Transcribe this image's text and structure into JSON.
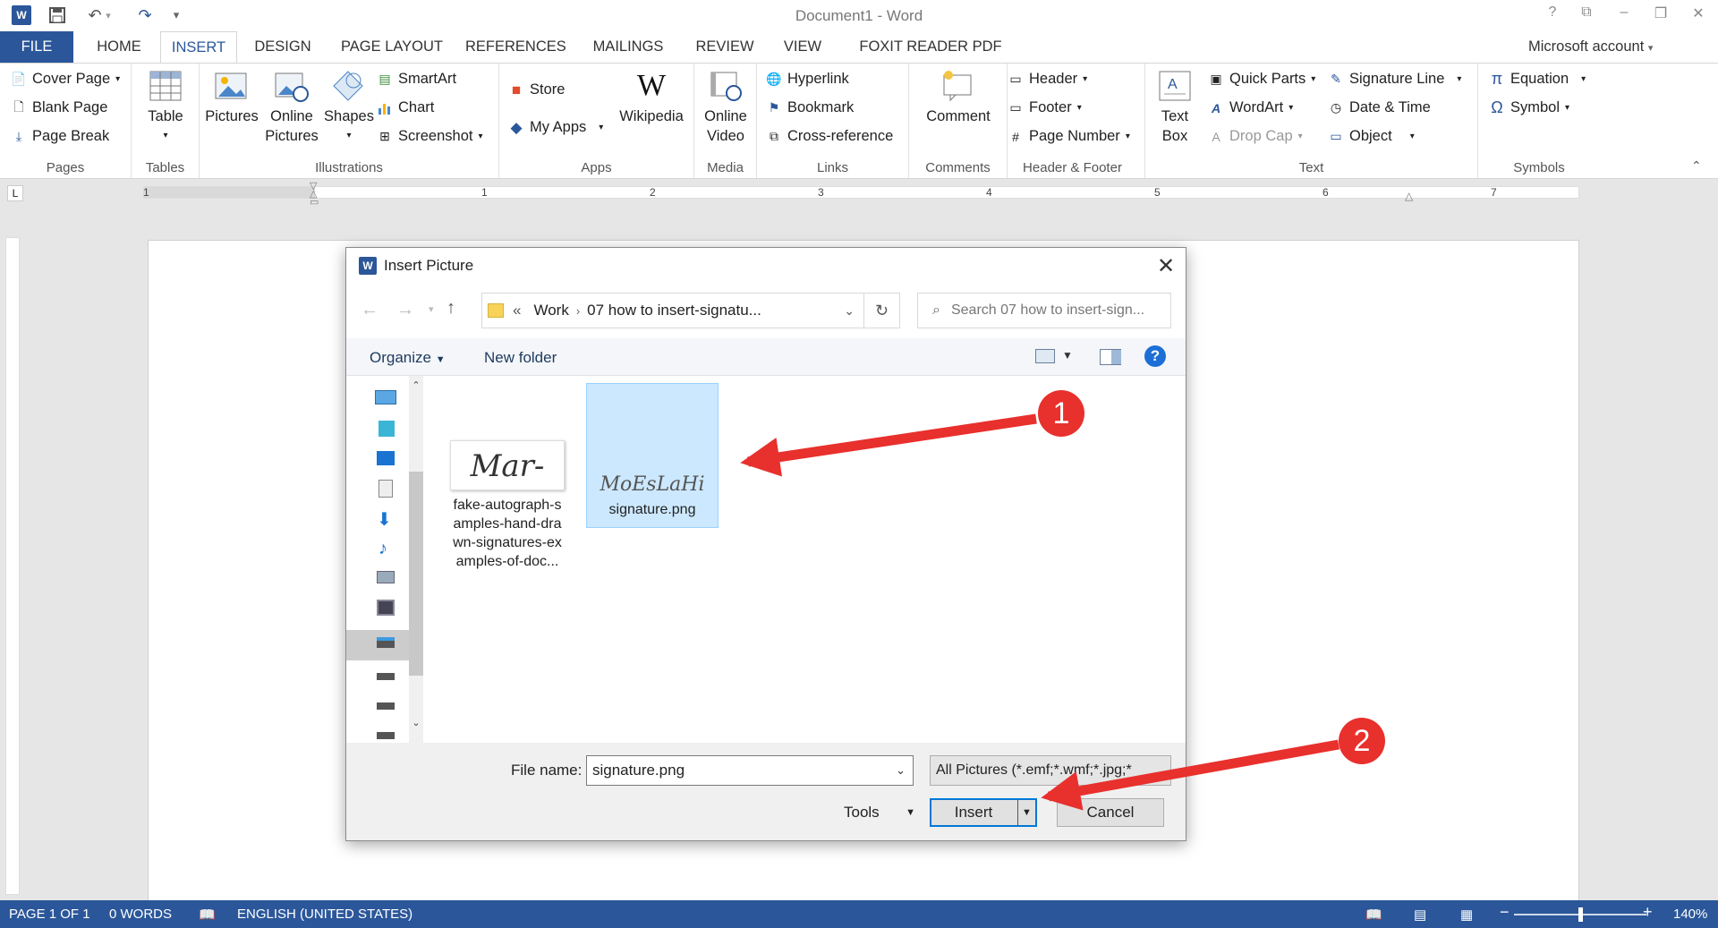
{
  "app": {
    "window_title": "Document1 - Word",
    "help_glyph": "?",
    "account_label": "Microsoft account"
  },
  "tabs": [
    "FILE",
    "HOME",
    "INSERT",
    "DESIGN",
    "PAGE LAYOUT",
    "REFERENCES",
    "MAILINGS",
    "REVIEW",
    "VIEW",
    "FOXIT READER PDF"
  ],
  "ribbon": {
    "pages": {
      "label": "Pages",
      "cover_page": "Cover Page",
      "blank_page": "Blank Page",
      "page_break": "Page Break"
    },
    "tables": {
      "label": "Tables",
      "table": "Table"
    },
    "illustrations": {
      "label": "Illustrations",
      "pictures": "Pictures",
      "online_pictures_1": "Online",
      "online_pictures_2": "Pictures",
      "shapes": "Shapes",
      "smartart": "SmartArt",
      "chart": "Chart",
      "screenshot": "Screenshot"
    },
    "apps": {
      "label": "Apps",
      "store": "Store",
      "my_apps": "My Apps",
      "wikipedia": "Wikipedia",
      "wiki_glyph": "W"
    },
    "media": {
      "label": "Media",
      "online_video_1": "Online",
      "online_video_2": "Video"
    },
    "links": {
      "label": "Links",
      "hyperlink": "Hyperlink",
      "bookmark": "Bookmark",
      "cross_reference": "Cross-reference"
    },
    "comments": {
      "label": "Comments",
      "comment": "Comment"
    },
    "header_footer": {
      "label": "Header & Footer",
      "header": "Header",
      "footer": "Footer",
      "page_number": "Page Number"
    },
    "text": {
      "label": "Text",
      "text_box_1": "Text",
      "text_box_2": "Box",
      "quick_parts": "Quick Parts",
      "wordart": "WordArt",
      "drop_cap": "Drop Cap",
      "signature_line": "Signature Line",
      "date_time": "Date & Time",
      "object": "Object"
    },
    "symbols": {
      "label": "Symbols",
      "equation": "Equation",
      "symbol": "Symbol"
    }
  },
  "ruler": {
    "marks": [
      "1",
      "1",
      "2",
      "3",
      "4",
      "5",
      "6",
      "7"
    ],
    "tab_glyph": "L"
  },
  "dialog": {
    "title": "Insert Picture",
    "breadcrumb": {
      "prefix": "«",
      "parts": [
        "Work",
        "07 how to insert-signatu..."
      ]
    },
    "search_placeholder": "Search 07 how to insert-sign...",
    "organize_label": "Organize",
    "new_folder_label": "New folder",
    "help_glyph": "?",
    "files": [
      {
        "name_lines": [
          "fake-autograph-s",
          "amples-hand-dra",
          "wn-signatures-ex",
          "amples-of-doc..."
        ],
        "thumb_text": "Mar-",
        "selected": false
      },
      {
        "name_lines": [
          "signature.png"
        ],
        "thumb_text": "MoEsLaHi",
        "selected": true
      }
    ],
    "file_name_label": "File name:",
    "file_name_value": "signature.png",
    "file_type_value": "All Pictures (*.emf;*.wmf;*.jpg;*",
    "tools_label": "Tools",
    "insert_label": "Insert",
    "cancel_label": "Cancel"
  },
  "annotations": [
    "1",
    "2"
  ],
  "annotation_color": "#e8302d",
  "status": {
    "page": "PAGE 1 OF 1",
    "words": "0 WORDS",
    "language": "ENGLISH (UNITED STATES)",
    "zoom": "140%",
    "zoom_level_fraction": 0.5
  },
  "colors": {
    "accent": "#2b579a"
  }
}
